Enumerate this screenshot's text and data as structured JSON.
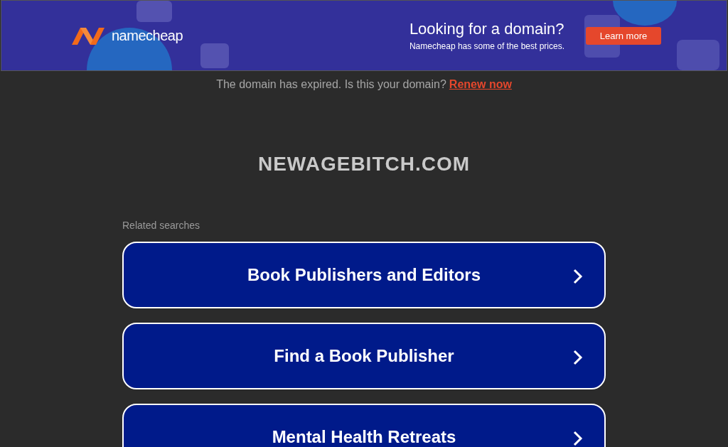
{
  "banner": {
    "brand": "namecheap",
    "headline": "Looking for a domain?",
    "subline": "Namecheap has some of the best prices.",
    "button": "Learn more"
  },
  "notice": {
    "text": "The domain has expired. Is this your domain?",
    "link": "Renew now"
  },
  "domain": "NEWAGEBITCH.COM",
  "related": {
    "heading": "Related searches",
    "items": [
      {
        "label": "Book Publishers and Editors"
      },
      {
        "label": "Find a Book Publisher"
      },
      {
        "label": "Mental Health Retreats"
      }
    ]
  }
}
